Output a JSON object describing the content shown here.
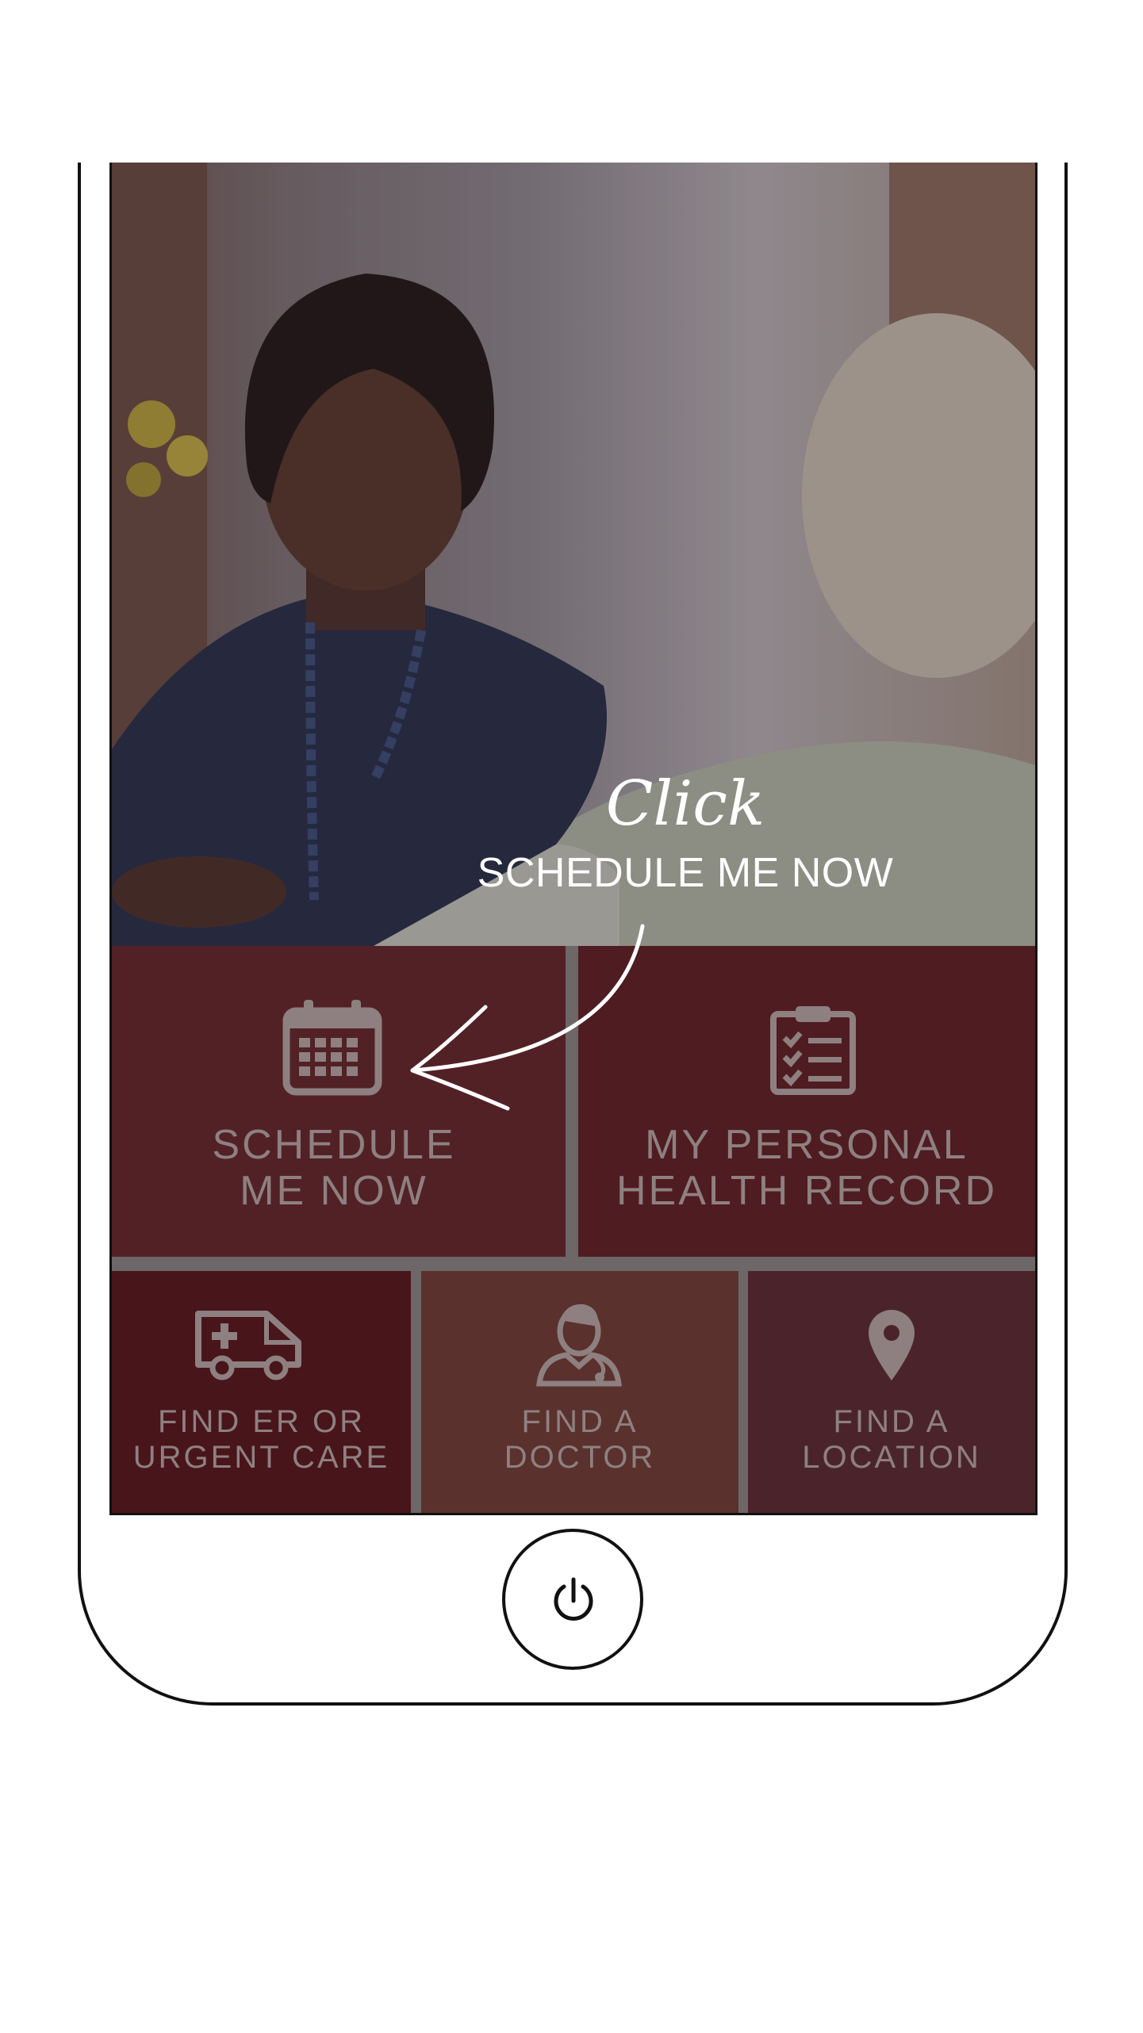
{
  "callout": {
    "script_text": "Click",
    "instruction": "SCHEDULE ME NOW"
  },
  "tiles": {
    "schedule": {
      "line1": "SCHEDULE",
      "line2": "ME NOW",
      "icon": "calendar-icon"
    },
    "record": {
      "line1": "MY PERSONAL",
      "line2": "HEALTH RECORD",
      "icon": "clipboard-checklist-icon"
    },
    "er": {
      "line1": "FIND ER OR",
      "line2": "URGENT CARE",
      "icon": "ambulance-icon"
    },
    "doctor": {
      "line1": "FIND A",
      "line2": "DOCTOR",
      "icon": "doctor-icon"
    },
    "location": {
      "line1": "FIND A",
      "line2": "LOCATION",
      "icon": "map-pin-icon"
    }
  },
  "home_button": {
    "icon": "power-icon"
  },
  "colors": {
    "tile_schedule": "#522126",
    "tile_record": "#4f1c21",
    "tile_er": "#48151b",
    "tile_doctor": "#5a312d",
    "tile_location": "#4b242b",
    "tile_text": "#8e8080"
  }
}
